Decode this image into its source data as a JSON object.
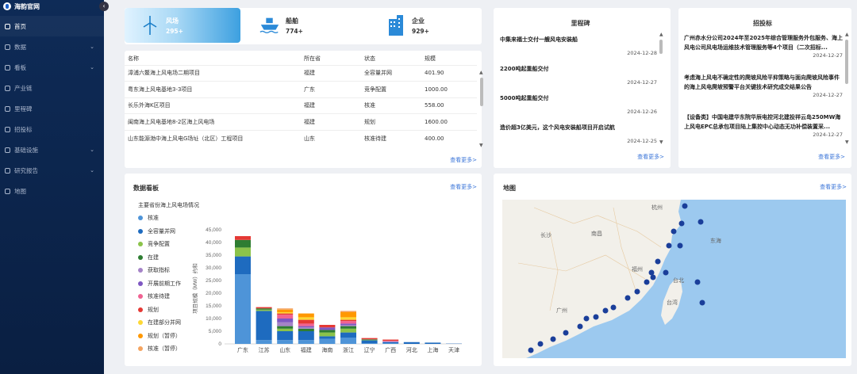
{
  "app": {
    "title": "海韵官网"
  },
  "sidebar": {
    "collapse_icon": "chevron-left",
    "items": [
      {
        "label": "首页",
        "icon": "home-icon",
        "active": true,
        "has_children": false
      },
      {
        "label": "数据",
        "icon": "data-icon",
        "has_children": true
      },
      {
        "label": "看板",
        "icon": "dashboard-icon",
        "has_children": true
      },
      {
        "label": "产业链",
        "icon": "chain-icon",
        "has_children": false
      },
      {
        "label": "里程碑",
        "icon": "flag-icon",
        "has_children": false
      },
      {
        "label": "招投标",
        "icon": "bid-icon",
        "has_children": false
      },
      {
        "label": "基础设施",
        "icon": "infra-icon",
        "has_children": true
      },
      {
        "label": "研究报告",
        "icon": "report-icon",
        "has_children": true
      },
      {
        "label": "地图",
        "icon": "map-icon",
        "has_children": false
      }
    ]
  },
  "stats": [
    {
      "name": "风场",
      "value": "295+",
      "icon": "wind-turbine-icon"
    },
    {
      "name": "船舶",
      "value": "774+",
      "icon": "ship-icon"
    },
    {
      "name": "企业",
      "value": "929+",
      "icon": "building-icon"
    }
  ],
  "windfarm_table": {
    "columns": [
      "名称",
      "所在省",
      "状态",
      "规模"
    ],
    "rows": [
      [
        "漳浦六鳌海上风电场二期项目",
        "福建",
        "全容量并网",
        "401.90"
      ],
      [
        "粤东海上风电基地3-3项目",
        "广东",
        "竞争配置",
        "1000.00"
      ],
      [
        "长乐外海K区项目",
        "福建",
        "核准",
        "558.00"
      ],
      [
        "闽南海上风电基地8-2区海上风电场",
        "福建",
        "规划",
        "1600.00"
      ],
      [
        "山东能源渤中海上风电G场址（北区）工程项目",
        "山东",
        "核准待建",
        "400.00"
      ]
    ],
    "more": "查看更多>"
  },
  "milestones": {
    "title": "里程碑",
    "items": [
      {
        "text": "中集来福士交付一艘风电安装船",
        "date": "2024-12-28"
      },
      {
        "text": "2200吨起重船交付",
        "date": "2024-12-27"
      },
      {
        "text": "5000吨起重船交付",
        "date": "2024-12-26"
      },
      {
        "text": "造价超3亿美元，这个风电安装船项目开启试航",
        "date": "2024-12-25"
      }
    ],
    "more": "查看更多>"
  },
  "bidding": {
    "title": "招投标",
    "items": [
      {
        "text": "广州赤水分公司2024年至2025年综合管理服务外包服务、海上风电公司风电场运维技术管理服务等4个项目（二次招标...",
        "date": "2024-12-27"
      },
      {
        "text": "考虑海上风电不确定性的爬坡风险平抑策略与面向爬坡风险事件的海上风电爬坡预警平台关键技术研究成交结果公告",
        "date": "2024-12-27"
      },
      {
        "text": "【设备类】中国电建华东院华辰电控河北建投祥云岛250MW海上风电EPC总承包项目陆上集控中心动态无功补偿装置采...",
        "date": "2024-12-27"
      }
    ],
    "more": "查看更多>"
  },
  "dashboard": {
    "title": "数据看板",
    "more": "查看更多>"
  },
  "map_panel": {
    "title": "地图",
    "more": "查看更多>",
    "labels": [
      "杭州",
      "长沙",
      "南昌",
      "东海",
      "福州",
      "台北",
      "台湾",
      "广州"
    ]
  },
  "chart_data": {
    "type": "bar",
    "stacked": true,
    "title": "主要省份海上风电场情况",
    "ylabel": "项目规模（MW）约和",
    "ylim": [
      0,
      50000
    ],
    "yticks": [
      "0",
      "5,000",
      "10,000",
      "15,000",
      "20,000",
      "25,000",
      "30,000",
      "35,000",
      "40,000",
      "45,000"
    ],
    "categories": [
      "广东",
      "江苏",
      "山东",
      "福建",
      "海南",
      "浙江",
      "辽宁",
      "广西",
      "河北",
      "上海",
      "天津"
    ],
    "series": [
      {
        "name": "核准",
        "color": "#4e94d8",
        "values": [
          27500,
          1500,
          1500,
          1500,
          2000,
          2500,
          200,
          200,
          0,
          0,
          0
        ]
      },
      {
        "name": "全容量并网",
        "color": "#1e6bbf",
        "values": [
          7000,
          11500,
          3500,
          3500,
          1000,
          2000,
          1200,
          500,
          700,
          500,
          100
        ]
      },
      {
        "name": "竞争配置",
        "color": "#8bc34a",
        "values": [
          3500,
          500,
          1000,
          0,
          1500,
          1500,
          200,
          0,
          0,
          0,
          0
        ]
      },
      {
        "name": "在建",
        "color": "#2e7d32",
        "values": [
          3000,
          500,
          1000,
          1000,
          1000,
          1000,
          200,
          0,
          0,
          0,
          0
        ]
      },
      {
        "name": "获取指标",
        "color": "#a583c7",
        "values": [
          0,
          0,
          1500,
          500,
          0,
          500,
          0,
          300,
          0,
          0,
          0
        ]
      },
      {
        "name": "开展前期工作",
        "color": "#7e57c2",
        "values": [
          0,
          0,
          1500,
          500,
          1000,
          500,
          0,
          0,
          0,
          0,
          0
        ]
      },
      {
        "name": "核准待建",
        "color": "#f06292",
        "values": [
          0,
          0,
          1500,
          1000,
          0,
          1000,
          0,
          200,
          0,
          0,
          0
        ]
      },
      {
        "name": "规划",
        "color": "#e53935",
        "values": [
          1500,
          500,
          500,
          1500,
          1000,
          500,
          500,
          500,
          0,
          0,
          0
        ]
      },
      {
        "name": "在建部分并网",
        "color": "#fdd835",
        "values": [
          0,
          0,
          500,
          1000,
          0,
          1000,
          0,
          0,
          0,
          0,
          0
        ]
      },
      {
        "name": "规划（暂停）",
        "color": "#ff9800",
        "values": [
          0,
          0,
          1000,
          1500,
          0,
          2000,
          0,
          0,
          0,
          0,
          0
        ]
      },
      {
        "name": "核准（暂停）",
        "color": "#f4a460",
        "values": [
          0,
          0,
          500,
          0,
          0,
          500,
          0,
          0,
          0,
          0,
          0
        ]
      }
    ]
  }
}
